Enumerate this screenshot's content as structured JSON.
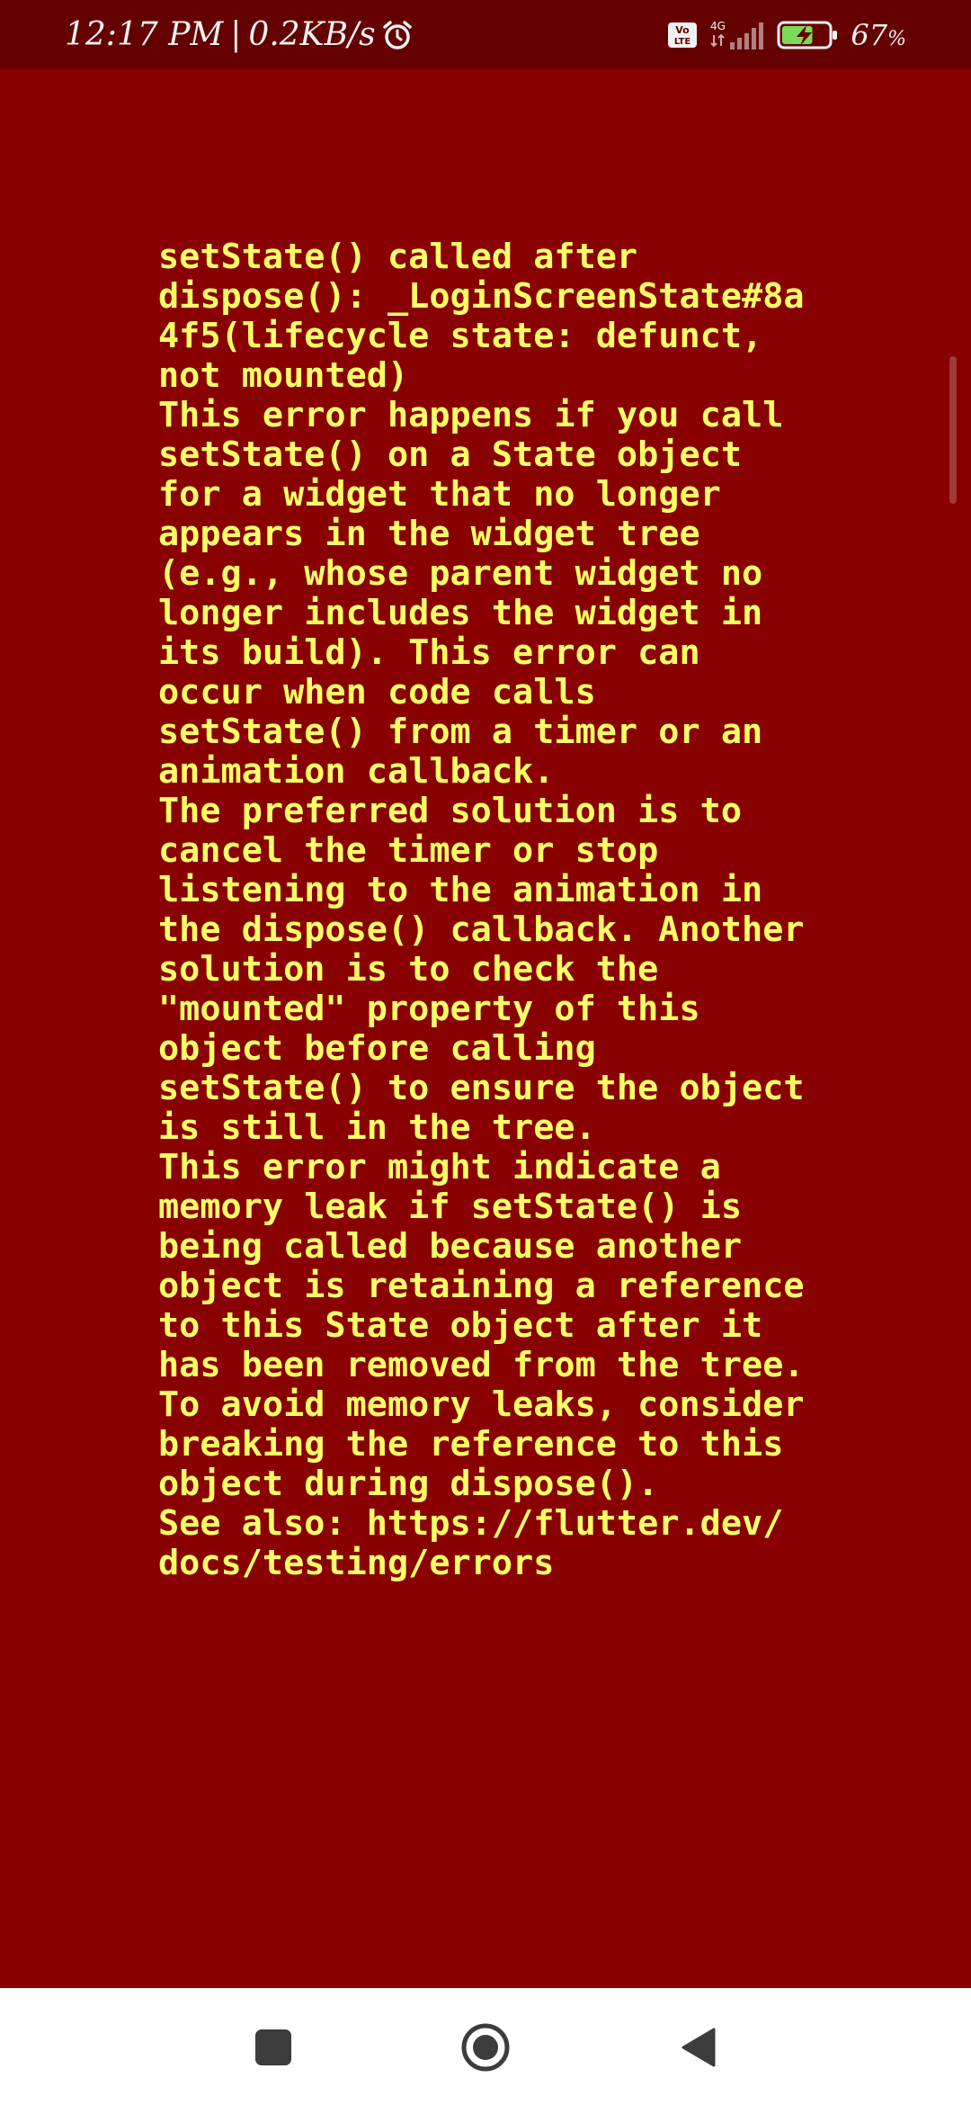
{
  "status_bar": {
    "time": "12:17 PM",
    "separator": "|",
    "net_speed": "0.2KB/s",
    "network_type": "4G",
    "volte_label": "Vo LTE",
    "battery_percent": "67",
    "battery_unit": "%",
    "battery_level": 0.67,
    "icons": [
      "alarm-icon",
      "volte-icon",
      "signal-icon",
      "battery-charging-icon"
    ]
  },
  "error": {
    "lines": [
      "setState() called after",
      "dispose(): _LoginScreenState#8a",
      "4f5(lifecycle state: defunct,",
      "not mounted)",
      "This error happens if you call",
      "setState() on a State object",
      "for a widget that no longer",
      "appears in the widget tree",
      "(e.g., whose parent widget no",
      "longer includes the widget in",
      "its build). This error can",
      "occur when code calls",
      "setState() from a timer or an",
      "animation callback.",
      "The preferred solution is to",
      "cancel the timer or stop",
      "listening to the animation in",
      "the dispose() callback. Another",
      "solution is to check the",
      "\"mounted\" property of this",
      "object before calling",
      "setState() to ensure the object",
      "is still in the tree.",
      "This error might indicate a",
      "memory leak if setState() is",
      "being called because another",
      "object is retaining a reference",
      "to this State object after it",
      "has been removed from the tree.",
      "To avoid memory leaks, consider",
      "breaking the reference to this",
      "object during dispose().",
      "See also: https://flutter.dev/",
      "docs/testing/errors"
    ]
  },
  "colors": {
    "background": "#880000",
    "status_bar": "#650000",
    "error_text": "#ffff66",
    "nav_bar": "#ffffff",
    "nav_icon": "#3c3c3c",
    "battery_fill": "#7ed957"
  },
  "nav_bar": {
    "icons": [
      "recents-icon",
      "home-icon",
      "back-icon"
    ]
  }
}
